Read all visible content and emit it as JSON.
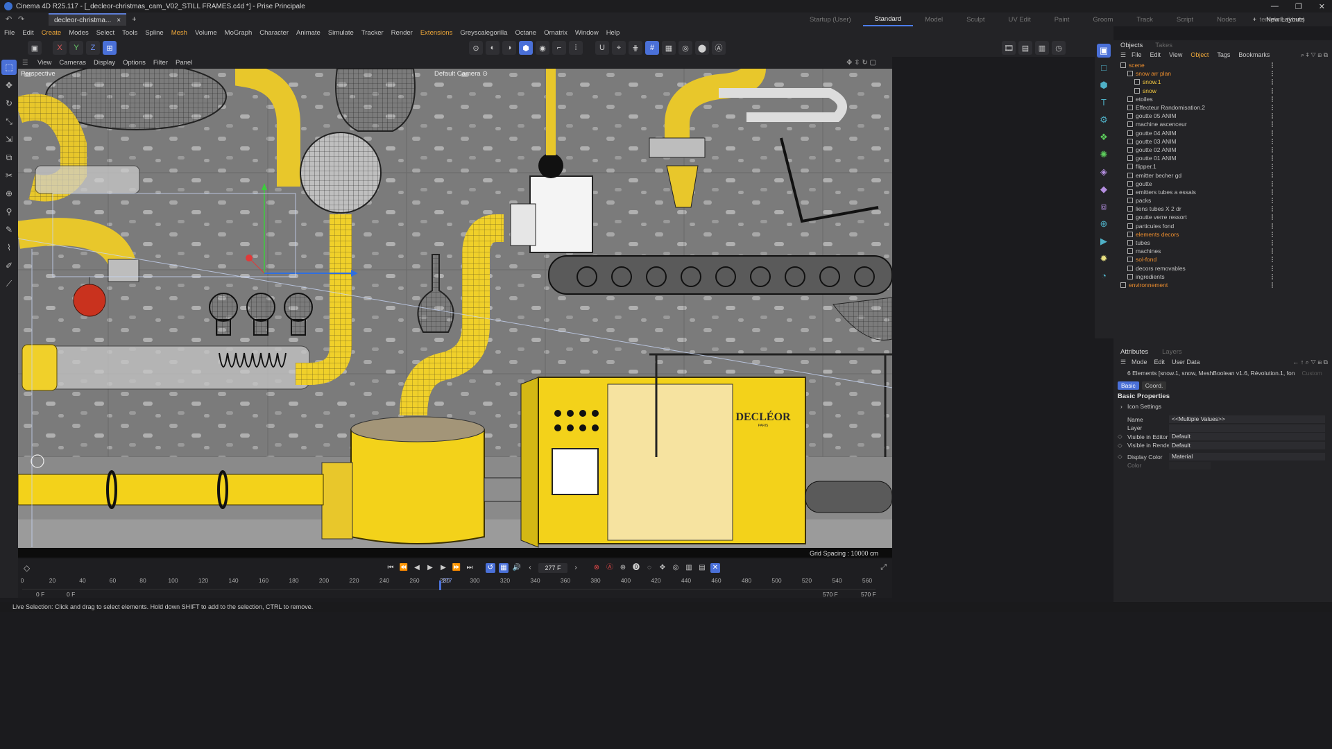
{
  "window": {
    "title": "Cinema 4D R25.117 - [_decleor-christmas_cam_V02_STILL FRAMES.c4d *] - Prise Principale",
    "controls": [
      "—",
      "❐",
      "✕"
    ]
  },
  "doc_tab": {
    "name": "decleor-christma...",
    "close": "×",
    "add": "+"
  },
  "layouts": [
    "Startup (User)",
    "Standard",
    "Model",
    "Sculpt",
    "UV Edit",
    "Paint",
    "Groom",
    "Track",
    "Script",
    "Nodes",
    "template (User)"
  ],
  "new_layouts": "New Layouts",
  "menu": [
    "File",
    "Edit",
    "Create",
    "Modes",
    "Select",
    "Tools",
    "Spline",
    "Mesh",
    "Volume",
    "MoGraph",
    "Character",
    "Animate",
    "Simulate",
    "Tracker",
    "Render",
    "Extensions",
    "Greyscalegorilla",
    "Octane",
    "Ornatrix",
    "Window",
    "Help"
  ],
  "axis_buttons": [
    "X",
    "Y",
    "Z"
  ],
  "viewport": {
    "menu": [
      "View",
      "Cameras",
      "Display",
      "Options",
      "Filter",
      "Panel"
    ],
    "label": "Perspective",
    "camera": "Default Camera ⊙",
    "grid_spacing": "Grid Spacing : 10000 cm",
    "product_text": "DECLÉOR",
    "product_sub": "PARIS"
  },
  "timeline": {
    "current_frame": "277 F",
    "start": "0 F",
    "start2": "0 F",
    "end": "570 F",
    "end2": "570 F",
    "ticks": [
      "0",
      "20",
      "40",
      "60",
      "80",
      "100",
      "120",
      "140",
      "160",
      "180",
      "200",
      "220",
      "240",
      "260",
      "280",
      "300",
      "320",
      "340",
      "360",
      "380",
      "400",
      "420",
      "440",
      "460",
      "480",
      "500",
      "520",
      "540",
      "560"
    ],
    "playhead_label": "277",
    "playhead_frame": 277,
    "max_frame": 570
  },
  "status": "Live Selection: Click and drag to select elements. Hold down SHIFT to add to the selection, CTRL to remove.",
  "objects_panel": {
    "tabs": [
      "Objects",
      "Takes"
    ],
    "menu": [
      "File",
      "Edit",
      "View",
      "Object",
      "Tags",
      "Bookmarks"
    ],
    "items": [
      {
        "name": "scene",
        "style": "orange",
        "indent": 0
      },
      {
        "name": "snow arr plan",
        "style": "orange",
        "indent": 1
      },
      {
        "name": "snow.1",
        "style": "yellow",
        "indent": 2
      },
      {
        "name": "snow",
        "style": "yellow",
        "indent": 2
      },
      {
        "name": "etoiles",
        "style": "",
        "indent": 1
      },
      {
        "name": "Effecteur Randomisation.2",
        "style": "",
        "indent": 1
      },
      {
        "name": "goutte 05 ANIM",
        "style": "",
        "indent": 1
      },
      {
        "name": "machine ascenceur",
        "style": "",
        "indent": 1
      },
      {
        "name": "goutte 04 ANIM",
        "style": "",
        "indent": 1
      },
      {
        "name": "goutte 03 ANIM",
        "style": "",
        "indent": 1
      },
      {
        "name": "goutte 02 ANIM",
        "style": "",
        "indent": 1
      },
      {
        "name": "goutte 01 ANIM",
        "style": "",
        "indent": 1
      },
      {
        "name": "flipper.1",
        "style": "",
        "indent": 1
      },
      {
        "name": "emitter becher gd",
        "style": "",
        "indent": 1
      },
      {
        "name": "goutte",
        "style": "",
        "indent": 1
      },
      {
        "name": "emitters tubes a essais",
        "style": "",
        "indent": 1
      },
      {
        "name": "packs",
        "style": "",
        "indent": 1
      },
      {
        "name": "liens tubes X 2 dr",
        "style": "",
        "indent": 1
      },
      {
        "name": "goutte verre ressort",
        "style": "",
        "indent": 1
      },
      {
        "name": "particules fond",
        "style": "",
        "indent": 1
      },
      {
        "name": "elements decors",
        "style": "orange",
        "indent": 1
      },
      {
        "name": "tubes",
        "style": "",
        "indent": 1
      },
      {
        "name": "machines",
        "style": "",
        "indent": 1
      },
      {
        "name": "sol-fond",
        "style": "orange",
        "indent": 1
      },
      {
        "name": "decors removables",
        "style": "",
        "indent": 1
      },
      {
        "name": "ingredients",
        "style": "",
        "indent": 1
      },
      {
        "name": "environnement",
        "style": "orange",
        "indent": 0
      }
    ]
  },
  "attributes": {
    "tabs": [
      "Attributes",
      "Layers"
    ],
    "menu": [
      "Mode",
      "Edit",
      "User Data"
    ],
    "selection": "6 Elements [snow.1, snow, MeshBoolean v1.6, Révolution.1, fon",
    "custom": "Custom",
    "subtabs": [
      "Basic",
      "Coord."
    ],
    "section": "Basic Properties",
    "icon_settings": "Icon Settings",
    "rows": [
      {
        "label": "Name",
        "value": "<<Multiple Values>>"
      },
      {
        "label": "Layer",
        "value": ""
      },
      {
        "label": "Visible in Editor",
        "value": "Default"
      },
      {
        "label": "Visible in Renderer",
        "value": "Default"
      },
      {
        "label": "Display Color",
        "value": "Material"
      },
      {
        "label": "Color",
        "value": ""
      }
    ]
  },
  "colors": {
    "accent": "#4a70d8",
    "yellow_pipe": "#f3d21a",
    "background_wall": "#7a7a7a",
    "orange_label": "#ef8f2e"
  }
}
